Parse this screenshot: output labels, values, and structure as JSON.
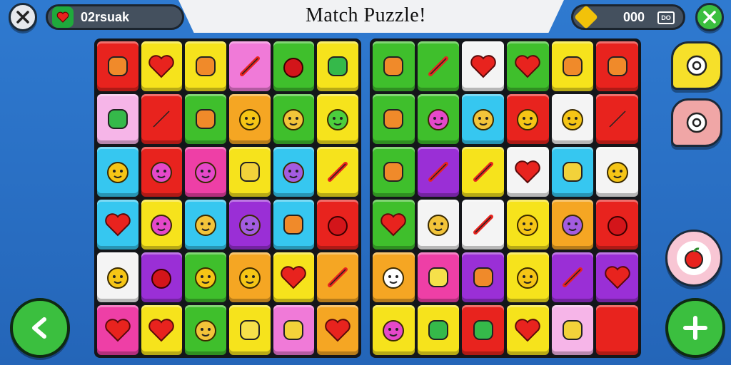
{
  "header": {
    "title": "Match Puzzle!",
    "player_name": "02rsuak",
    "coins": "000",
    "camera_label": "DO"
  },
  "colors": {
    "red": "#e8231e",
    "yellow": "#f6e31c",
    "pink": "#f07ad8",
    "green": "#3fbf2c",
    "orange": "#f5a623",
    "purple": "#9a2fd6",
    "cyan": "#36c7f0",
    "lightpink": "#f6b5e8",
    "white": "#f4f4f4",
    "magenta": "#ee3fa6"
  },
  "board_left": [
    [
      {
        "c": "red",
        "i": "spiky-plant"
      },
      {
        "c": "yellow",
        "i": "heart"
      },
      {
        "c": "yellow",
        "i": "bomb"
      },
      {
        "c": "pink",
        "i": "paint-brush"
      },
      {
        "c": "green",
        "i": "tomato"
      },
      {
        "c": "yellow",
        "i": "bucket"
      }
    ],
    [
      {
        "c": "lightpink",
        "i": "trash-can"
      },
      {
        "c": "red",
        "i": "brush"
      },
      {
        "c": "green",
        "i": "cupcake"
      },
      {
        "c": "orange",
        "i": "spiky-face"
      },
      {
        "c": "green",
        "i": "cat-face"
      },
      {
        "c": "yellow",
        "i": "frog-face"
      }
    ],
    [
      {
        "c": "cyan",
        "i": "sun-face"
      },
      {
        "c": "red",
        "i": "flame-face"
      },
      {
        "c": "magenta",
        "i": "flame-face"
      },
      {
        "c": "yellow",
        "i": "box"
      },
      {
        "c": "cyan",
        "i": "blob-face"
      },
      {
        "c": "yellow",
        "i": "marker"
      }
    ],
    [
      {
        "c": "cyan",
        "i": "heart"
      },
      {
        "c": "yellow",
        "i": "berry-face"
      },
      {
        "c": "cyan",
        "i": "cat-face"
      },
      {
        "c": "purple",
        "i": "drop-face"
      },
      {
        "c": "cyan",
        "i": "gear-blob"
      },
      {
        "c": "red",
        "i": "grapes"
      }
    ],
    [
      {
        "c": "white",
        "i": "lion-face"
      },
      {
        "c": "purple",
        "i": "strawberry"
      },
      {
        "c": "green",
        "i": "lion-face"
      },
      {
        "c": "orange",
        "i": "spiky-face"
      },
      {
        "c": "yellow",
        "i": "heart"
      },
      {
        "c": "orange",
        "i": "marker"
      }
    ],
    [
      {
        "c": "magenta",
        "i": "heart"
      },
      {
        "c": "yellow",
        "i": "heart"
      },
      {
        "c": "green",
        "i": "smile-face"
      },
      {
        "c": "yellow",
        "i": "square-face"
      },
      {
        "c": "pink",
        "i": "cake"
      },
      {
        "c": "orange",
        "i": "heart"
      }
    ]
  ],
  "board_right": [
    [
      {
        "c": "green",
        "i": "leaf"
      },
      {
        "c": "green",
        "i": "paint-brush"
      },
      {
        "c": "white",
        "i": "heart"
      },
      {
        "c": "green",
        "i": "heart"
      },
      {
        "c": "yellow",
        "i": "pizza"
      },
      {
        "c": "red",
        "i": "drop"
      }
    ],
    [
      {
        "c": "green",
        "i": "pill"
      },
      {
        "c": "green",
        "i": "flame-face"
      },
      {
        "c": "cyan",
        "i": "cat-face"
      },
      {
        "c": "red",
        "i": "sun-face"
      },
      {
        "c": "white",
        "i": "lion-face"
      },
      {
        "c": "red",
        "i": "brush"
      }
    ],
    [
      {
        "c": "green",
        "i": "leaf"
      },
      {
        "c": "purple",
        "i": "scissors"
      },
      {
        "c": "yellow",
        "i": "scissors"
      },
      {
        "c": "white",
        "i": "heart"
      },
      {
        "c": "cyan",
        "i": "gift"
      },
      {
        "c": "white",
        "i": "crown-face"
      }
    ],
    [
      {
        "c": "green",
        "i": "heart"
      },
      {
        "c": "white",
        "i": "bunny-face"
      },
      {
        "c": "white",
        "i": "spoon"
      },
      {
        "c": "yellow",
        "i": "party-face"
      },
      {
        "c": "orange",
        "i": "drop-face"
      },
      {
        "c": "red",
        "i": "apple"
      }
    ],
    [
      {
        "c": "orange",
        "i": "white-face"
      },
      {
        "c": "magenta",
        "i": "box-face"
      },
      {
        "c": "purple",
        "i": "acorn"
      },
      {
        "c": "yellow",
        "i": "sun-face"
      },
      {
        "c": "purple",
        "i": "marker"
      },
      {
        "c": "purple",
        "i": "heart"
      }
    ],
    [
      {
        "c": "yellow",
        "i": "berry-face"
      },
      {
        "c": "yellow",
        "i": "bucket"
      },
      {
        "c": "red",
        "i": "bucket"
      },
      {
        "c": "yellow",
        "i": "heart"
      },
      {
        "c": "lightpink",
        "i": "cake"
      },
      {
        "c": "red",
        "i": "blank"
      }
    ]
  ]
}
